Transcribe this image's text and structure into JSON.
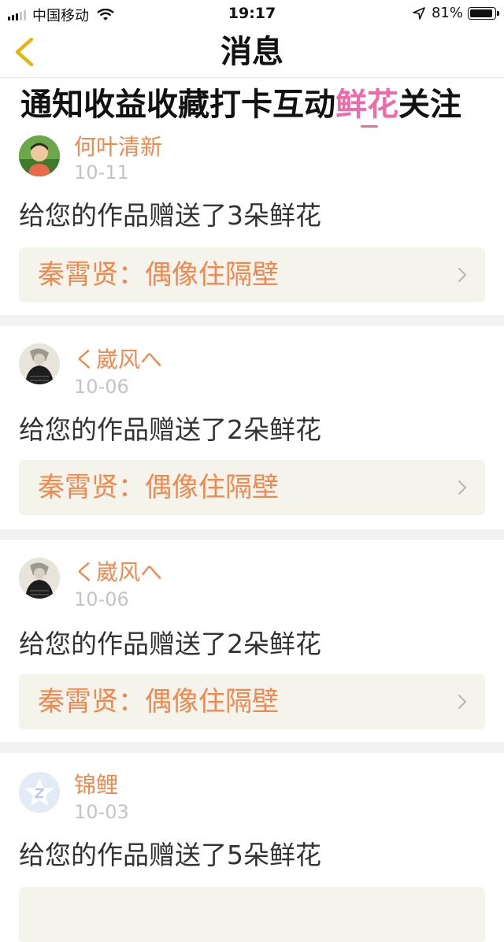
{
  "status_bar": {
    "carrier": "中国移动",
    "time": "19:17",
    "battery": "81%",
    "battery_level": 0.81
  },
  "nav": {
    "title": "消息"
  },
  "tabs": [
    {
      "label": "通知"
    },
    {
      "label": "收益"
    },
    {
      "label": "收藏"
    },
    {
      "label": "打卡"
    },
    {
      "label": "互动"
    },
    {
      "label": "鲜花",
      "active": true
    },
    {
      "label": "关注"
    }
  ],
  "messages": [
    {
      "user": "何叶清新",
      "date": "10-11",
      "text": "给您的作品赠送了3朵鲜花",
      "work": "秦霄贤：偶像住隔壁",
      "avatar": "boy-photo-icon"
    },
    {
      "user": "く崴风へ",
      "date": "10-06",
      "text": "给您的作品赠送了2朵鲜花",
      "work": "秦霄贤：偶像住隔壁",
      "avatar": "sketch-figure-icon"
    },
    {
      "user": "く崴风へ",
      "date": "10-06",
      "text": "给您的作品赠送了2朵鲜花",
      "work": "秦霄贤：偶像住隔壁",
      "avatar": "sketch-figure-icon"
    },
    {
      "user": "锦鲤",
      "date": "10-03",
      "text": "给您的作品赠送了5朵鲜花",
      "avatar": "default-star-avatar-icon"
    }
  ],
  "colors": {
    "accent_pink": "#ef6aa8",
    "name_orange": "#f2884d",
    "back_yellow": "#e6b40a",
    "box_bg": "#f4f4ec"
  }
}
